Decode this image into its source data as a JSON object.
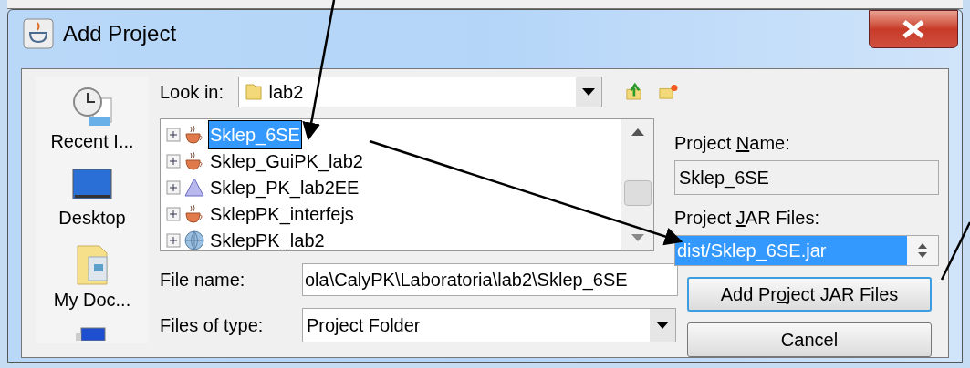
{
  "dialog": {
    "title": "Add Project"
  },
  "sidebar": {
    "items": [
      {
        "kind": "recent",
        "label": "Recent I..."
      },
      {
        "kind": "desktop",
        "label": "Desktop"
      },
      {
        "kind": "documents",
        "label": "My Doc..."
      },
      {
        "kind": "computer"
      }
    ]
  },
  "look_in": {
    "label": "Look in:",
    "value": "lab2"
  },
  "tree": {
    "items": [
      {
        "kind": "java",
        "label": "Sklep_6SE",
        "selected": true
      },
      {
        "kind": "java",
        "label": "Sklep_GuiPK_lab2",
        "selected": false
      },
      {
        "kind": "cone",
        "label": "Sklep_PK_lab2EE",
        "selected": false
      },
      {
        "kind": "java",
        "label": "SklepPK_interfejs",
        "selected": false
      },
      {
        "kind": "web",
        "label": "SklepPK_lab2",
        "selected": false
      }
    ]
  },
  "file_name": {
    "label": "File name:",
    "value": "ola\\CalyPK\\Laboratoria\\lab2\\Sklep_6SE"
  },
  "files_of_type": {
    "label": "Files of type:",
    "value": "Project Folder"
  },
  "project_name": {
    "label": {
      "pre": "Project ",
      "key": "N",
      "post": "ame:"
    },
    "value": "Sklep_6SE"
  },
  "jar_files": {
    "label": {
      "pre": "Project ",
      "key": "J",
      "post": "AR Files:"
    },
    "items": [
      {
        "label": "dist/Sklep_6SE.jar",
        "selected": true
      }
    ]
  },
  "buttons": [
    {
      "label": {
        "pre": "Add Pr",
        "key": "o",
        "post": "ject JAR Files"
      },
      "focused": true
    },
    {
      "label": {
        "pre": "Cancel"
      },
      "focused": false
    }
  ]
}
